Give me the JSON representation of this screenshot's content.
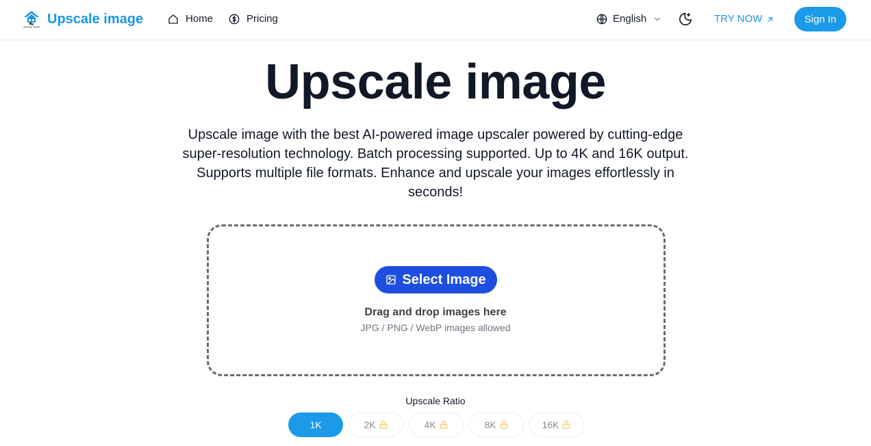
{
  "brand": {
    "name": "Upscale image",
    "logo_caption": "upscale image",
    "color": "#1a96e8"
  },
  "nav": {
    "home": {
      "label": "Home",
      "icon": "home-icon"
    },
    "pricing": {
      "label": "Pricing",
      "icon": "dollar-circle-icon"
    }
  },
  "header": {
    "language": {
      "label": "English",
      "icon": "globe-icon"
    },
    "theme_icon": "moon-sparkle-icon",
    "try_now": "TRY NOW",
    "sign_in": "Sign In"
  },
  "hero": {
    "title": "Upscale image",
    "description": "Upscale image with the best AI-powered image upscaler powered by cutting-edge super-resolution technology. Batch processing supported. Up to 4K and 16K output. Supports multiple file formats. Enhance and upscale your images effortlessly in seconds!"
  },
  "upload": {
    "button_label": "Select Image",
    "drag_text": "Drag and drop images here",
    "formats_text": "JPG / PNG / WebP images allowed"
  },
  "ratio": {
    "label": "Upscale Ratio",
    "options": [
      {
        "label": "1K",
        "locked": false,
        "selected": true
      },
      {
        "label": "2K",
        "locked": true,
        "selected": false
      },
      {
        "label": "4K",
        "locked": true,
        "selected": false
      },
      {
        "label": "8K",
        "locked": true,
        "selected": false
      },
      {
        "label": "16K",
        "locked": true,
        "selected": false
      }
    ]
  },
  "colors": {
    "primary": "#1a9ae8",
    "select_button": "#1d4ee0",
    "lock_icon": "#f2c94c"
  }
}
